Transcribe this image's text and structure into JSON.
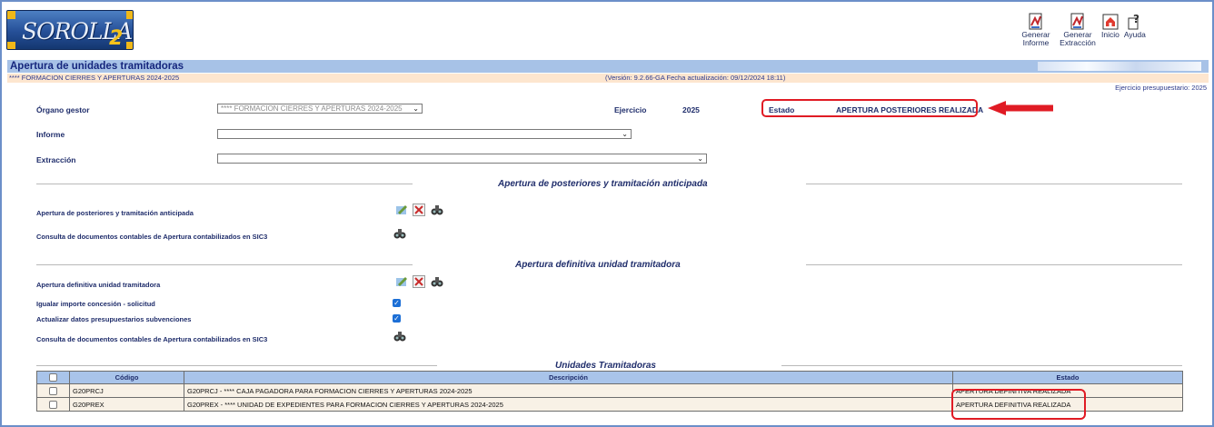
{
  "app": {
    "logo_text": "SOROLLA",
    "logo_suffix": "2"
  },
  "toolbar": {
    "items": [
      {
        "label": "Generar Informe",
        "icon": "report-icon"
      },
      {
        "label": "Generar Extracción",
        "icon": "extraction-icon"
      },
      {
        "label": "Inicio",
        "icon": "home-icon"
      },
      {
        "label": "Ayuda",
        "icon": "help-icon"
      }
    ]
  },
  "header": {
    "title": "Apertura de unidades tramitadoras",
    "subtitle": "**** FORMACION CIERRES Y APERTURAS 2024-2025",
    "version": "(Versión: 9.2.66-GA Fecha actualización: 09/12/2024 18:11)",
    "ejercicio_presupuestario": "Ejercicio presupuestario: 2025"
  },
  "form": {
    "organo_label": "Órgano gestor",
    "organo_value": "**** FORMACION CIERRES Y APERTURAS 2024-2025",
    "ejercicio_label": "Ejercicio",
    "ejercicio_value": "2025",
    "estado_label": "Estado",
    "estado_value": "APERTURA POSTERIORES REALIZADA",
    "informe_label": "Informe",
    "informe_value": "",
    "extraccion_label": "Extracción",
    "extraccion_value": ""
  },
  "section1": {
    "title": "Apertura de posteriores y tramitación anticipada",
    "row1_label": "Apertura de posteriores y tramitación anticipada",
    "row2_label": "Consulta de documentos contables de Apertura contabilizados en SIC3"
  },
  "section2": {
    "title": "Apertura definitiva unidad tramitadora",
    "row1_label": "Apertura definitiva unidad tramitadora",
    "row2_label": "Igualar importe concesión - solicitud",
    "row2_checked": true,
    "row3_label": "Actualizar datos presupuestarios subvenciones",
    "row3_checked": true,
    "row4_label": "Consulta de documentos contables de Apertura contabilizados en SIC3"
  },
  "section3": {
    "title": "Unidades Tramitadoras"
  },
  "table": {
    "headers": [
      "Código",
      "Descripción",
      "Estado"
    ],
    "rows": [
      {
        "codigo": "G20PRCJ",
        "descripcion": "G20PRCJ - **** CAJA PAGADORA PARA FORMACION CIERRES Y APERTURAS 2024-2025",
        "estado": "APERTURA DEFINITIVA REALIZADA"
      },
      {
        "codigo": "G20PREX",
        "descripcion": "G20PREX - **** UNIDAD DE EXPEDIENTES PARA FORMACION CIERRES Y APERTURAS 2024-2025",
        "estado": "APERTURA DEFINITIVA REALIZADA"
      }
    ]
  },
  "colors": {
    "accent_blue": "#a7c2e7",
    "highlight_red": "#e01b24",
    "peach": "#fde6cf"
  }
}
